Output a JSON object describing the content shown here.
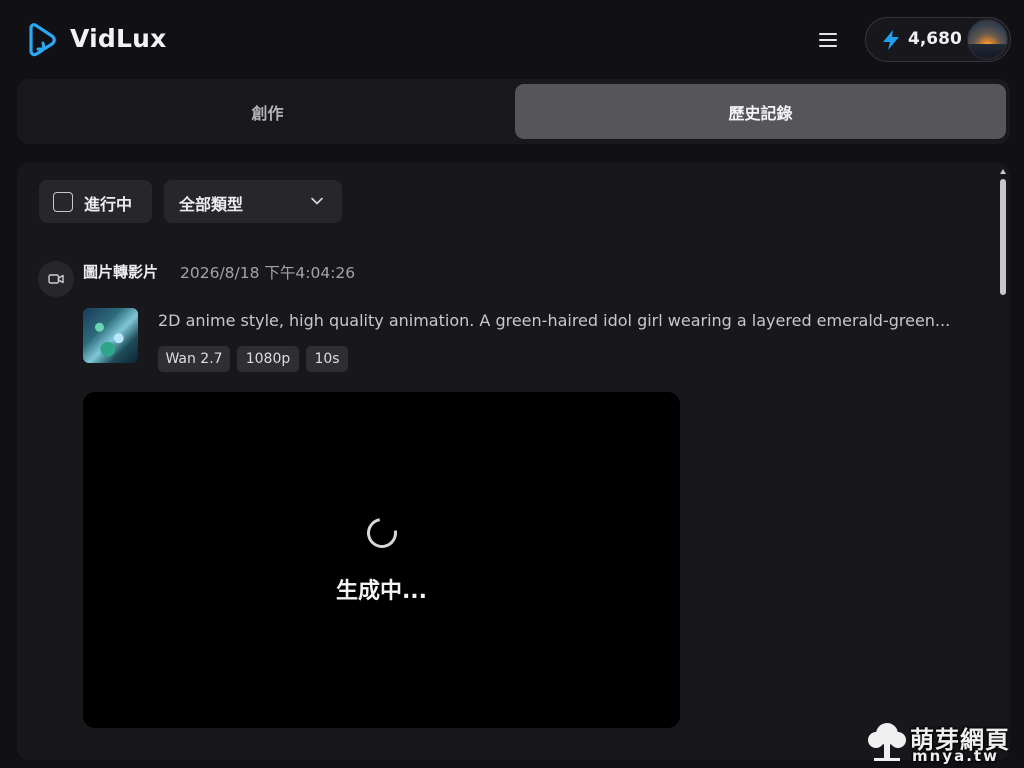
{
  "header": {
    "brand": "VidLux",
    "credits": "4,680",
    "colors": {
      "accent": "#1f9ff0"
    }
  },
  "tabs": [
    {
      "label": "創作",
      "active": false
    },
    {
      "label": "歷史記錄",
      "active": true
    }
  ],
  "filters": {
    "in_progress_label": "進行中",
    "in_progress_checked": false,
    "type_select_value": "全部類型"
  },
  "record": {
    "type": "圖片轉影片",
    "timestamp": "2026/8/18 下午4:04:26",
    "prompt": "2D anime style, high quality animation. A green-haired idol girl wearing a layered emerald-green...",
    "tags": [
      "Wan 2.7",
      "1080p",
      "10s"
    ],
    "status_text": "生成中..."
  },
  "watermark": {
    "title": "萌芽網頁",
    "url": "mnya.tw"
  }
}
